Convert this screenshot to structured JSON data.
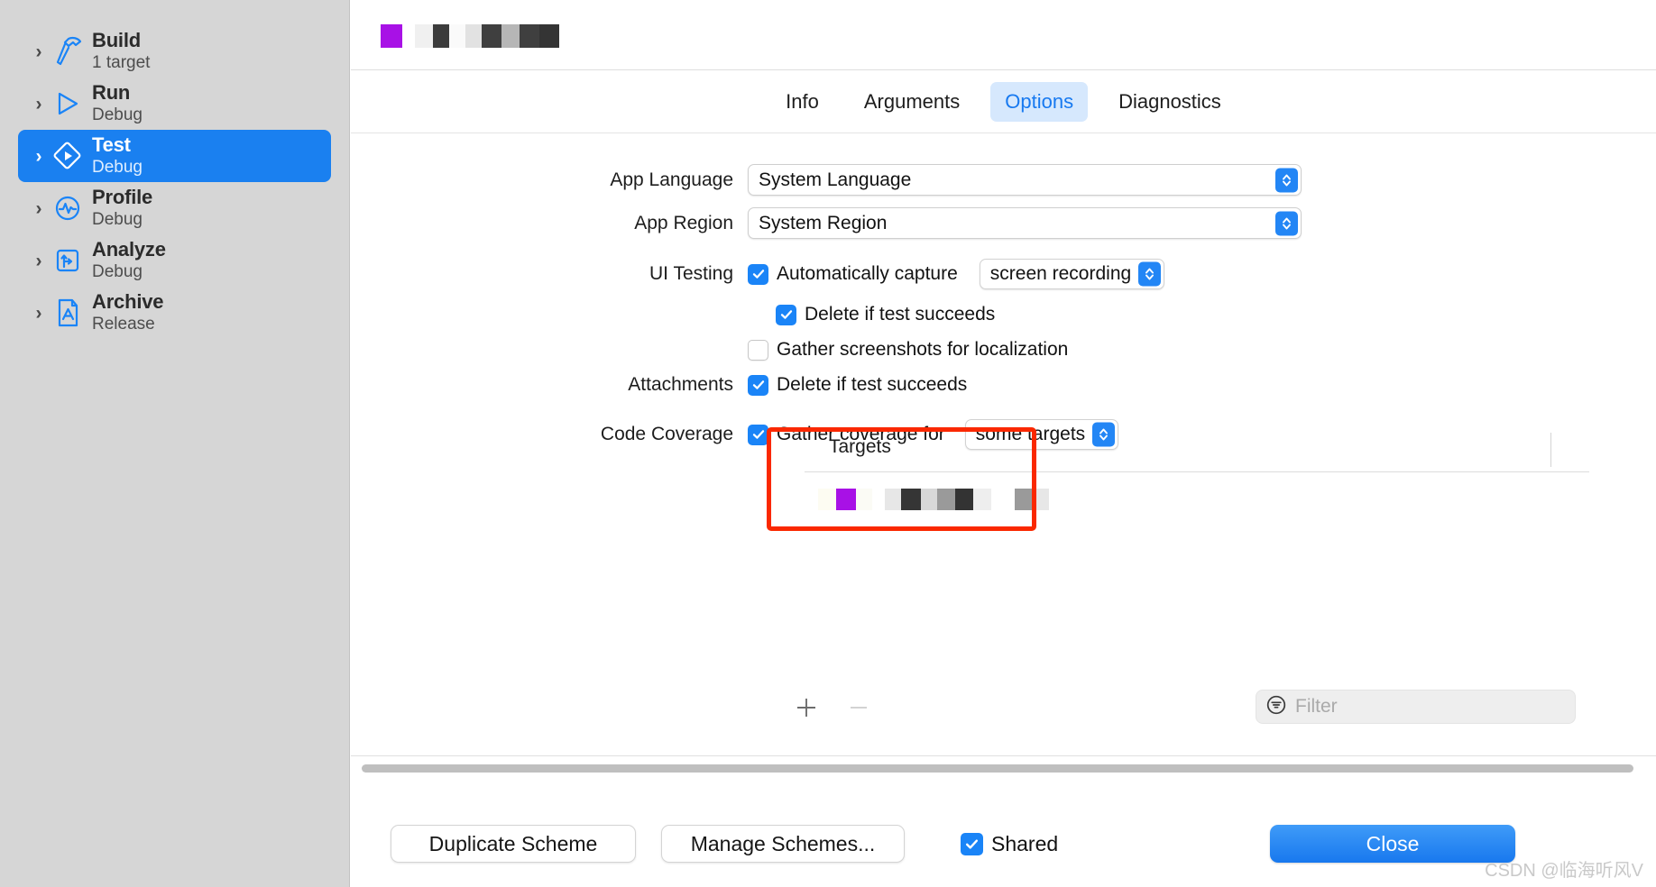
{
  "sidebar": {
    "items": [
      {
        "icon": "hammer-icon",
        "title": "Build",
        "subtitle": "1 target",
        "selected": false
      },
      {
        "icon": "play-icon",
        "title": "Run",
        "subtitle": "Debug",
        "selected": false
      },
      {
        "icon": "test-icon",
        "title": "Test",
        "subtitle": "Debug",
        "selected": true
      },
      {
        "icon": "profile-icon",
        "title": "Profile",
        "subtitle": "Debug",
        "selected": false
      },
      {
        "icon": "analyze-icon",
        "title": "Analyze",
        "subtitle": "Debug",
        "selected": false
      },
      {
        "icon": "archive-icon",
        "title": "Archive",
        "subtitle": "Release",
        "selected": false
      }
    ]
  },
  "tabs": [
    {
      "label": "Info",
      "active": false
    },
    {
      "label": "Arguments",
      "active": false
    },
    {
      "label": "Options",
      "active": true
    },
    {
      "label": "Diagnostics",
      "active": false
    }
  ],
  "options": {
    "app_language": {
      "label": "App Language",
      "value": "System Language"
    },
    "app_region": {
      "label": "App Region",
      "value": "System Region"
    },
    "ui_testing": {
      "label": "UI Testing",
      "auto_capture_label": "Automatically capture",
      "auto_capture_checked": true,
      "capture_mode": "screen recording",
      "delete_if_succeeds_label": "Delete if test succeeds",
      "delete_if_succeeds_checked": true,
      "gather_screenshots_label": "Gather screenshots for localization",
      "gather_screenshots_checked": false
    },
    "attachments": {
      "label": "Attachments",
      "delete_label": "Delete if test succeeds",
      "delete_checked": true
    },
    "code_coverage": {
      "label": "Code Coverage",
      "gather_label": "Gather coverage for",
      "gather_checked": true,
      "scope": "some targets"
    },
    "targets": {
      "column_header": "Targets",
      "add_label": "+",
      "remove_label": "−"
    }
  },
  "filter": {
    "placeholder": "Filter",
    "value": "",
    "icon": "filter-lines-icon"
  },
  "bottom": {
    "duplicate_label": "Duplicate Scheme",
    "manage_label": "Manage Schemes...",
    "shared_label": "Shared",
    "shared_checked": true,
    "close_label": "Close"
  },
  "watermark": "CSDN @临海听风V",
  "colors": {
    "accent_blue": "#1a84f7",
    "selection_blue": "#1a80f0",
    "tab_active_bg": "#d6e8fd",
    "tab_active_fg": "#1779f0",
    "highlight_red": "#fa2800",
    "sidebar_bg": "#d6d6d6",
    "app_icon_purple": "#a811e6"
  }
}
